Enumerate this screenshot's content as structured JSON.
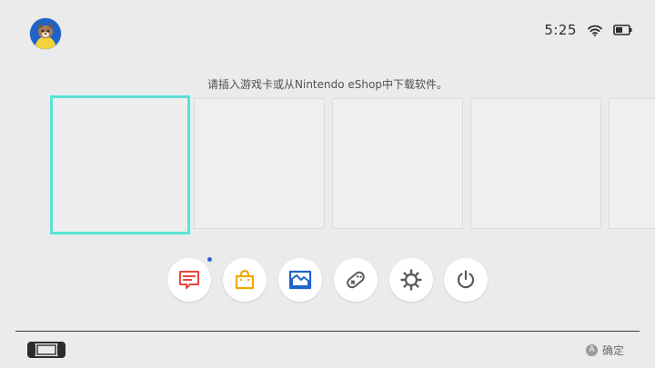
{
  "header": {
    "time": "5:25",
    "wifi_icon": "wifi-icon",
    "battery_icon": "battery-icon"
  },
  "message": "请插入游戏卡或从Nintendo eShop中下载软件。",
  "tiles": {
    "count_visible": 5,
    "selected_index": 0,
    "accent": "#5ce1d6"
  },
  "dock": {
    "items": [
      {
        "name": "news-icon",
        "color": "#e8453c",
        "has_notification": true
      },
      {
        "name": "eshop-icon",
        "color": "#f2a900"
      },
      {
        "name": "album-icon",
        "color": "#1e64c8"
      },
      {
        "name": "controllers-icon",
        "color": "#5a5a5a"
      },
      {
        "name": "settings-icon",
        "color": "#5a5a5a"
      },
      {
        "name": "power-icon",
        "color": "#5a5a5a"
      }
    ],
    "notification_color": "#2e5fd9"
  },
  "footer": {
    "console_icon": "console-icon",
    "confirm_button": "A",
    "confirm_label": "确定"
  }
}
